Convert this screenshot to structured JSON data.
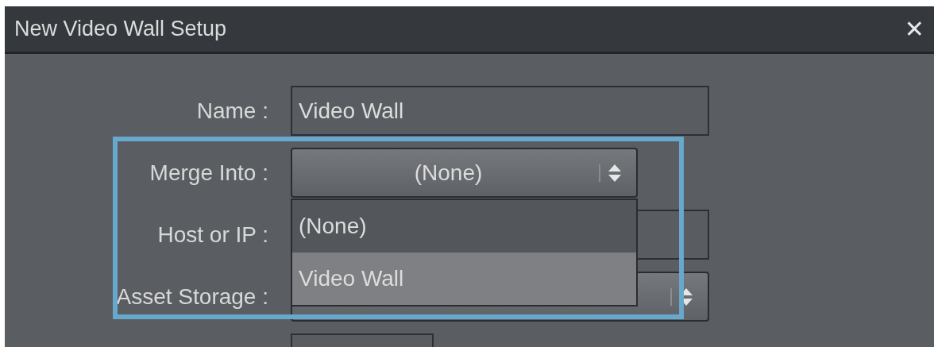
{
  "window": {
    "title": "New Video Wall Setup",
    "close": "✕"
  },
  "fields": [
    {
      "kind": "text",
      "label": "Name :",
      "value": "Video Wall"
    },
    {
      "kind": "select",
      "label": "Merge Into :",
      "value": "(None)",
      "expanded": true,
      "options": [
        {
          "label": "(None)",
          "highlighted": false
        },
        {
          "label": "Video Wall",
          "highlighted": true
        }
      ]
    },
    {
      "kind": "text",
      "label": "Host or IP :"
    },
    {
      "kind": "select",
      "label": "Asset Storage :",
      "expanded": false
    },
    {
      "kind": "short"
    }
  ]
}
